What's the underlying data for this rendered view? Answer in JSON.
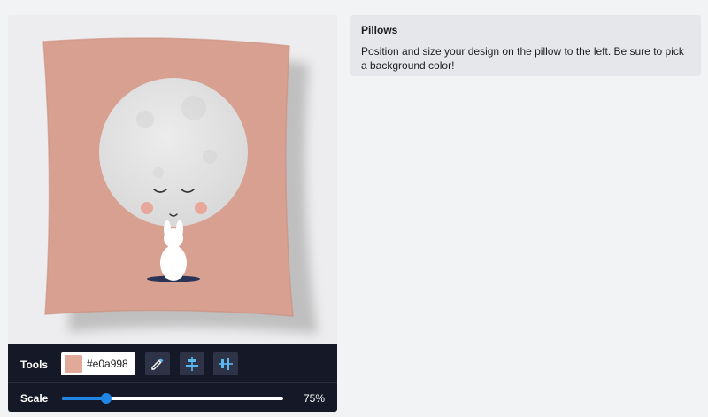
{
  "tools": {
    "label": "Tools",
    "background_color": "#e0a998",
    "color_hex_text": "#e0a998",
    "buttons": [
      {
        "name": "eyedropper-icon"
      },
      {
        "name": "align-vertical-center-icon"
      },
      {
        "name": "align-horizontal-center-icon"
      }
    ]
  },
  "scale": {
    "label": "Scale",
    "value_text": "75%",
    "fraction": 0.2
  },
  "info": {
    "title": "Pillows",
    "text": "Position and size your design on the pillow to the left. Be sure to pick a background color!"
  },
  "colors": {
    "toolbar_bg": "#151826",
    "accent": "#1f86e6",
    "pillow": "#d8a090"
  }
}
